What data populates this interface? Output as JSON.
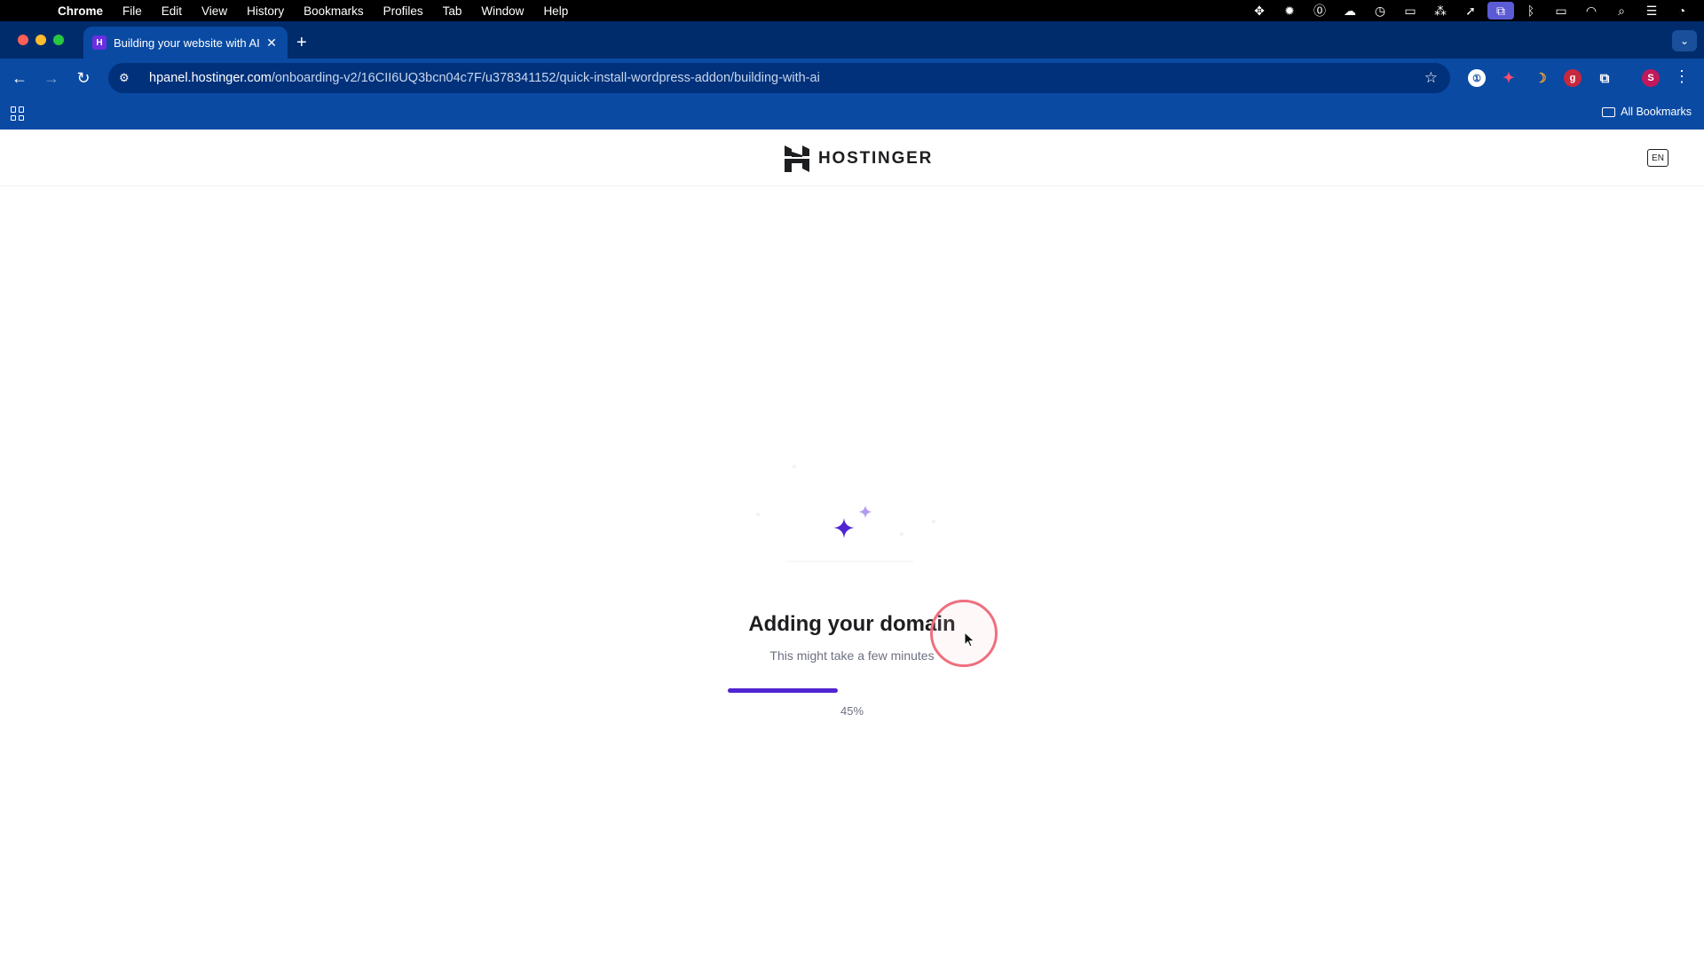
{
  "menubar": {
    "app": "Chrome",
    "items": [
      "File",
      "Edit",
      "View",
      "History",
      "Bookmarks",
      "Profiles",
      "Tab",
      "Window",
      "Help"
    ]
  },
  "tab": {
    "favicon_text": "H",
    "title": "Building your website with AI"
  },
  "address": {
    "host": "hpanel.hostinger.com",
    "path": "/onboarding-v2/16CII6UQ3bcn04c7F/u378341152/quick-install-wordpress-addon/building-with-ai"
  },
  "extensions": {
    "profile_initial": "S"
  },
  "bookmarks": {
    "all_label": "All Bookmarks"
  },
  "header": {
    "brand": "HOSTINGER",
    "language": "EN"
  },
  "main": {
    "heading": "Adding your domain",
    "subtitle": "This might take a few minutes",
    "progress_percent": 45,
    "progress_label": "45%"
  },
  "colors": {
    "accent": "#5025d1",
    "tab_strip": "#002c6b",
    "toolbar": "#0a4aa3"
  }
}
